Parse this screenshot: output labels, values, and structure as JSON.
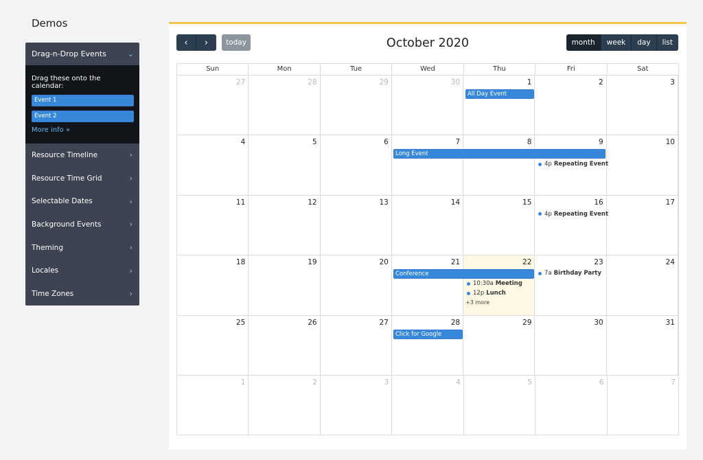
{
  "sidebar": {
    "title": "Demos",
    "active": {
      "label": "Drag-n-Drop Events",
      "drag_title": "Drag these onto the calendar:",
      "events": [
        "Event 1",
        "Event 2"
      ],
      "more_info": "More info »"
    },
    "items": [
      "Resource Timeline",
      "Resource Time Grid",
      "Selectable Dates",
      "Background Events",
      "Theming",
      "Locales",
      "Time Zones"
    ]
  },
  "calendar": {
    "title": "October 2020",
    "prev_icon": "‹",
    "next_icon": "›",
    "today_label": "today",
    "views": [
      "month",
      "week",
      "day",
      "list"
    ],
    "active_view": "month",
    "dow": [
      "Sun",
      "Mon",
      "Tue",
      "Wed",
      "Thu",
      "Fri",
      "Sat"
    ],
    "weeks": [
      [
        "27",
        "28",
        "29",
        "30",
        "1",
        "2",
        "3"
      ],
      [
        "4",
        "5",
        "6",
        "7",
        "8",
        "9",
        "10"
      ],
      [
        "11",
        "12",
        "13",
        "14",
        "15",
        "16",
        "17"
      ],
      [
        "18",
        "19",
        "20",
        "21",
        "22",
        "23",
        "24"
      ],
      [
        "25",
        "26",
        "27",
        "28",
        "29",
        "30",
        "31"
      ],
      [
        "1",
        "2",
        "3",
        "4",
        "5",
        "6",
        "7"
      ]
    ],
    "events": {
      "all_day": "All Day Event",
      "long": "Long Event",
      "repeat1_time": "4p",
      "repeat1_name": "Repeating Event",
      "repeat2_time": "4p",
      "repeat2_name": "Repeating Event",
      "conference": "Conference",
      "meeting_time": "10:30a",
      "meeting_name": "Meeting",
      "lunch_time": "12p",
      "lunch_name": "Lunch",
      "more": "+3 more",
      "birthday_time": "7a",
      "birthday_name": "Birthday Party",
      "google": "Click for Google"
    },
    "colors": {
      "event": "#3788d8",
      "today_bg": "#fcf8e3",
      "accent_border": "#f5c44c",
      "button": "#2c3e50"
    }
  }
}
